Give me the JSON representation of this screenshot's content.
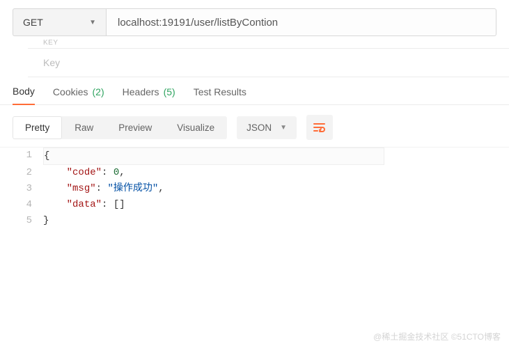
{
  "request": {
    "method": "GET",
    "url": "localhost:19191/user/listByContion"
  },
  "params": {
    "header": "KEY",
    "key_placeholder": "Key"
  },
  "responseTabs": {
    "body": "Body",
    "cookies": "Cookies",
    "cookies_count": "(2)",
    "headers": "Headers",
    "headers_count": "(5)",
    "test_results": "Test Results"
  },
  "viewModes": {
    "pretty": "Pretty",
    "raw": "Raw",
    "preview": "Preview",
    "visualize": "Visualize"
  },
  "lang": {
    "selected": "JSON"
  },
  "json_lines": {
    "l1": "{",
    "l2_key": "\"code\"",
    "l2_val": "0",
    "l3_key": "\"msg\"",
    "l3_val": "\"操作成功\"",
    "l4_key": "\"data\"",
    "l4_val": "[]",
    "l5": "}"
  },
  "response_payload": {
    "code": 0,
    "msg": "操作成功",
    "data": []
  },
  "line_numbers": [
    "1",
    "2",
    "3",
    "4",
    "5"
  ],
  "watermark": "@稀土掘金技术社区   ©51CTO博客",
  "colors": {
    "accent": "#ff6c37",
    "count_green": "#2fa460",
    "json_key": "#a31515",
    "json_num": "#1a6b32",
    "json_str": "#0451a5"
  }
}
